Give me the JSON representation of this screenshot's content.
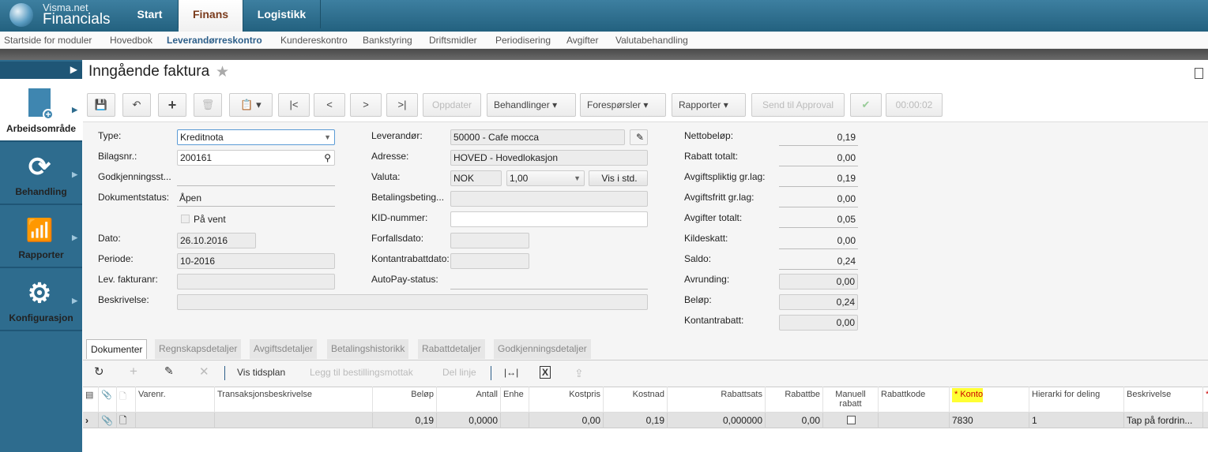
{
  "app": {
    "brand_small": "Visma.net",
    "brand_large": "Financials"
  },
  "main_tabs": [
    {
      "label": "Start"
    },
    {
      "label": "Finans"
    },
    {
      "label": "Logistikk"
    }
  ],
  "subnav": [
    "Startside for moduler",
    "Hovedbok",
    "Leverandørreskontro",
    "Kundereskontro",
    "Bankstyring",
    "Driftsmidler",
    "Periodisering",
    "Avgifter",
    "Valutabehandling"
  ],
  "sidebar": [
    {
      "label": "Arbeidsområde",
      "icon": "new-document-icon"
    },
    {
      "label": "Behandling",
      "icon": "refresh-icon"
    },
    {
      "label": "Rapporter",
      "icon": "bar-chart-icon"
    },
    {
      "label": "Konfigurasjon",
      "icon": "gear-icon"
    }
  ],
  "page": {
    "title": "Inngående faktura"
  },
  "toolbar": {
    "oppdater": "Oppdater",
    "behandlinger": "Behandlinger",
    "foresporsler": "Forespørsler",
    "rapporter": "Rapporter",
    "send_approval": "Send til Approval",
    "timer": "00:00:02"
  },
  "form": {
    "type_label": "Type:",
    "type_value": "Kreditnota",
    "bilagsnr_label": "Bilagsnr.:",
    "bilagsnr_value": "200161",
    "godkj_label": "Godkjenningsst...",
    "dokstatus_label": "Dokumentstatus:",
    "dokstatus_value": "Åpen",
    "pavent_label": "På vent",
    "dato_label": "Dato:",
    "dato_value": "26.10.2016",
    "periode_label": "Periode:",
    "periode_value": "10-2016",
    "levfaktura_label": "Lev. fakturanr:",
    "beskrivelse_label": "Beskrivelse:",
    "leverandor_label": "Leverandør:",
    "leverandor_value": "50000 - Cafe mocca",
    "adresse_label": "Adresse:",
    "adresse_value": "HOVED - Hovedlokasjon",
    "valuta_label": "Valuta:",
    "valuta_value": "NOK",
    "kurs_value": "1,00",
    "vis_std": "Vis i std.",
    "betaling_label": "Betalingsbeting...",
    "kid_label": "KID-nummer:",
    "forfall_label": "Forfallsdato:",
    "kontantdato_label": "Kontantrabattdato:",
    "autopay_label": "AutoPay-status:"
  },
  "totals": [
    {
      "label": "Nettobeløp:",
      "value": "0,19"
    },
    {
      "label": "Rabatt totalt:",
      "value": "0,00"
    },
    {
      "label": "Avgiftspliktig gr.lag:",
      "value": "0,19"
    },
    {
      "label": "Avgiftsfritt gr.lag:",
      "value": "0,00"
    },
    {
      "label": "Avgifter totalt:",
      "value": "0,05"
    },
    {
      "label": "Kildeskatt:",
      "value": "0,00"
    },
    {
      "label": "Saldo:",
      "value": "0,24"
    },
    {
      "label": "Avrunding:",
      "value": "0,00"
    },
    {
      "label": "Beløp:",
      "value": "0,24"
    },
    {
      "label": "Kontantrabatt:",
      "value": "0,00"
    }
  ],
  "detail_tabs": [
    "Dokumenter",
    "Regnskapsdetaljer",
    "Avgiftsdetaljer",
    "Betalingshistorikk",
    "Rabattdetaljer",
    "Godkjenningsdetaljer"
  ],
  "grid_toolbar": {
    "vis_tidsplan": "Vis tidsplan",
    "legg_til": "Legg til bestillingsmottak",
    "del_linje": "Del linje"
  },
  "grid": {
    "columns": [
      "Varenr.",
      "Transaksjonsbeskrivelse",
      "Beløp",
      "Antall",
      "Enhe",
      "Kostpris",
      "Kostnad",
      "Rabattsats",
      "Rabattbe",
      "Manuell rabatt",
      "Rabattkode",
      "* Konto",
      "Hierarki for deling",
      "Beskrivelse"
    ],
    "row": {
      "belop": "0,19",
      "antall": "0,0000",
      "kostpris": "0,00",
      "kostnad": "0,19",
      "rabattsats": "0,000000",
      "rabattbe": "0,00",
      "konto": "7830",
      "hierarki": "1",
      "beskrivelse": "Tap på fordrin..."
    }
  },
  "colors": {
    "brand": "#2e6c8e",
    "highlight": "#ffff33"
  }
}
